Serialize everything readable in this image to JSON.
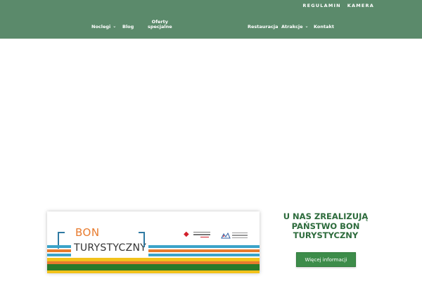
{
  "colors": {
    "header_bg": "#5b8a6b",
    "heading_green": "#2d6b3c",
    "button_green": "#3d8c4a",
    "stripe_blue": "#3aa3c9",
    "stripe_orange": "#e87b2e",
    "stripe_yellow": "#f2c21b",
    "stripe_green": "#2a7a2a"
  },
  "top_links": [
    "REGULAMIN",
    "KAMERA"
  ],
  "nav": {
    "noclegi": "Noclegi",
    "blog": "Blog",
    "oferty_line1": "Oferty",
    "oferty_line2": "specjalne",
    "restauracja": "Restauracja",
    "atrakcje": "Atrakcje",
    "kontakt": "Kontakt",
    "chevron": "⌄"
  },
  "promo": {
    "bon_word": "BON",
    "turystyczny_word": "TURYSTYCZNY",
    "heading_line1": "U NAS ZREALIZUJĄ",
    "heading_line2": "PAŃSTWO BON",
    "heading_line3": "TURYSTYCZNY",
    "button_label": "Więcej informacji"
  }
}
